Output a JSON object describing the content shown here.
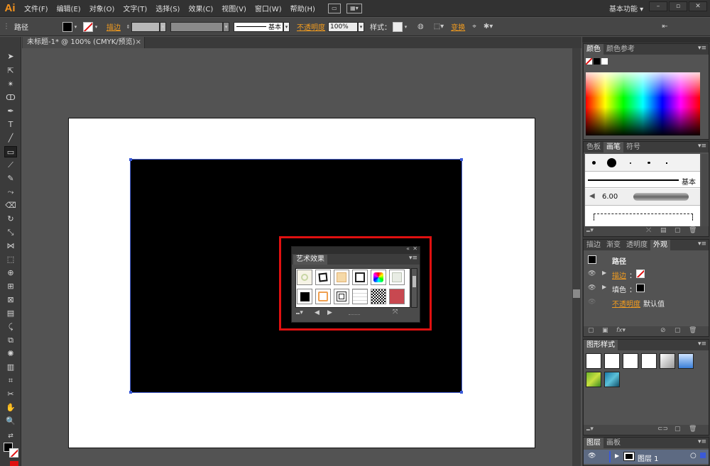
{
  "app": {
    "logo": "Ai",
    "workspace": "基本功能"
  },
  "menu": [
    "文件(F)",
    "编辑(E)",
    "对象(O)",
    "文字(T)",
    "选择(S)",
    "效果(C)",
    "视图(V)",
    "窗口(W)",
    "帮助(H)"
  ],
  "control": {
    "selection": "路径",
    "stroke_label": "描边",
    "stroke_profile": "基本",
    "opacity_label": "不透明度",
    "opacity_value": "100%",
    "style_label": "样式",
    "transform_label": "变换"
  },
  "document": {
    "tab_title": "未标题-1* @ 100% (CMYK/预览)",
    "close": "×"
  },
  "art_effects_panel": {
    "title": "艺术效果"
  },
  "color_panel": {
    "tabs": [
      "颜色",
      "颜色参考"
    ]
  },
  "brush_panel": {
    "tabs": [
      "色板",
      "画笔",
      "符号"
    ],
    "basic_label": "基本",
    "brush_size": "6.00"
  },
  "appearance_panel": {
    "tabs": [
      "描边",
      "渐变",
      "透明度",
      "外观"
    ],
    "object": "路径",
    "stroke": "描边",
    "fill": "填色",
    "opacity": "不透明度",
    "opacity_value": "默认值"
  },
  "graphic_styles_panel": {
    "tabs": [
      "图形样式"
    ]
  },
  "layers_panel": {
    "tabs": [
      "图层",
      "画板"
    ],
    "layer_name": "图层 1"
  },
  "colors": {
    "accent": "#f29c1f",
    "highlight": "#e01010",
    "selection": "#3a5ad8"
  }
}
